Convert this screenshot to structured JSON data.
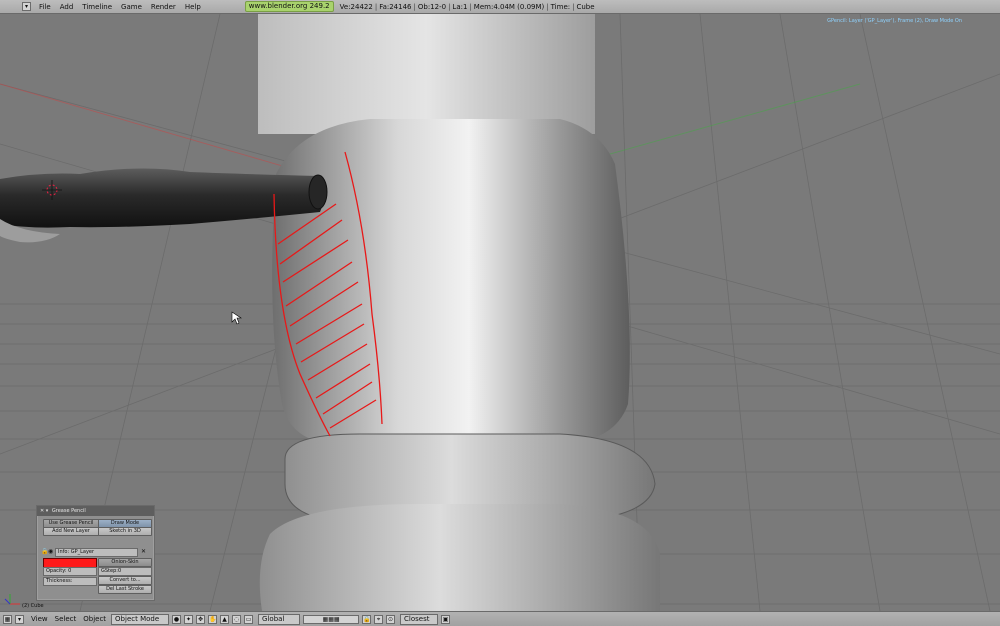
{
  "topbar": {
    "menus": [
      "File",
      "Add",
      "Timeline",
      "Game",
      "Render",
      "Help"
    ],
    "url": "www.blender.org 249.2",
    "stats": [
      "Ve:24422",
      "Fa:24146",
      "Ob:12-0",
      "La:1",
      "Mem:4.04M (0.09M)",
      "Time:",
      "Cube"
    ]
  },
  "viewport": {
    "overlay_text": "GPencil: Layer ('GP_Layer'), Frame (2), Draw Mode On",
    "object_label": "(2) Cube"
  },
  "panel": {
    "title": "Grease Pencil",
    "buttons": {
      "use_gp": "Use Grease Pencil",
      "draw_mode": "Draw Mode",
      "add_layer": "Add New Layer",
      "sketch_3d": "Sketch in 3D"
    },
    "layer_info": "Info: GP_Layer",
    "opacity": "Opacity: 0",
    "thickness": "Thickness:",
    "onion_skin": "Onion-Skin",
    "gstep": "GStep:0",
    "convert": "Convert to...",
    "del_last": "Del Last Stroke",
    "stroke_color": "#ff1a1a"
  },
  "bottombar": {
    "menus": [
      "View",
      "Select",
      "Object"
    ],
    "mode": "Object Mode",
    "orientation": "Global",
    "snap": "Closest"
  }
}
